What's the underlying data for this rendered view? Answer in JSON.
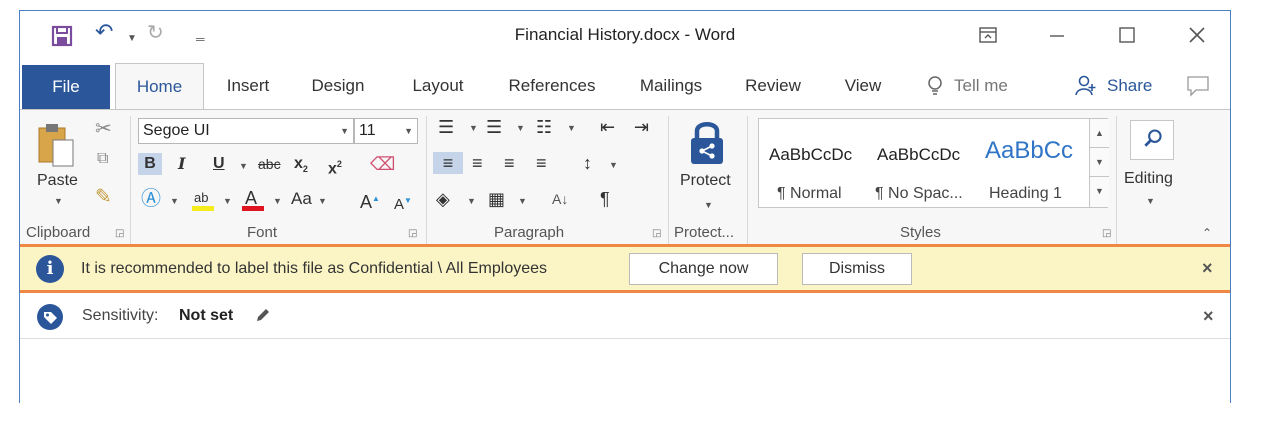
{
  "window": {
    "title": "Financial History.docx  -  Word"
  },
  "tabs": {
    "file": "File",
    "home": "Home",
    "insert": "Insert",
    "design": "Design",
    "layout": "Layout",
    "references": "References",
    "mailings": "Mailings",
    "review": "Review",
    "view": "View",
    "tell_me": "Tell me",
    "share": "Share"
  },
  "ribbon": {
    "clipboard": {
      "paste": "Paste",
      "group": "Clipboard"
    },
    "font": {
      "name": "Segoe UI",
      "size": "11",
      "bold": "B",
      "italic": "I",
      "underline": "U",
      "strike": "abc",
      "subscript": "x",
      "superscript": "x",
      "change_case": "Aa",
      "grow": "A",
      "shrink": "A",
      "group": "Font"
    },
    "paragraph": {
      "group": "Paragraph",
      "sort": "A",
      "pilcrow": "¶"
    },
    "protect": {
      "label": "Protect",
      "group": "Protect..."
    },
    "styles": {
      "group": "Styles",
      "items": [
        {
          "sample": "AaBbCcDc",
          "name": "¶ Normal"
        },
        {
          "sample": "AaBbCcDc",
          "name": "¶ No Spac..."
        },
        {
          "sample": "AaBbCc",
          "name": "Heading 1"
        }
      ]
    },
    "editing": {
      "label": "Editing"
    }
  },
  "message_bar": {
    "text": "It is recommended to label this file as Confidential \\ All Employees",
    "change_now": "Change now",
    "dismiss": "Dismiss",
    "close": "×"
  },
  "sensitivity_bar": {
    "label": "Sensitivity:",
    "value": "Not set",
    "close": "×"
  },
  "colors": {
    "word_blue": "#2b579a",
    "message_bg": "#fbf5c6",
    "highlight_border": "#ef8844",
    "title_bar_border": "#4a7fc1"
  }
}
